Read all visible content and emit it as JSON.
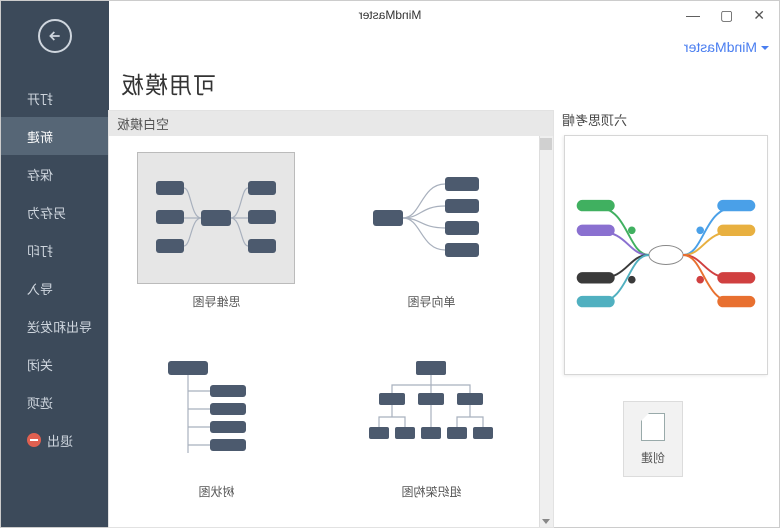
{
  "window": {
    "title": "MindMaster"
  },
  "brand": "MindMaster",
  "sidebar": {
    "items": [
      {
        "label": "打开"
      },
      {
        "label": "新建"
      },
      {
        "label": "保存"
      },
      {
        "label": "另存为"
      },
      {
        "label": "打印"
      },
      {
        "label": "导入"
      },
      {
        "label": "导出和发送"
      },
      {
        "label": "关闭"
      },
      {
        "label": "选项"
      },
      {
        "label": "退出"
      }
    ]
  },
  "page": {
    "title": "可用模板",
    "section": "空白模板",
    "preview_heading": "六顶思考帽",
    "create_label": "创建"
  },
  "templates": {
    "items": [
      {
        "label": "思维导图"
      },
      {
        "label": "单向导图"
      },
      {
        "label": "树状图"
      },
      {
        "label": "组织架构图"
      }
    ]
  }
}
